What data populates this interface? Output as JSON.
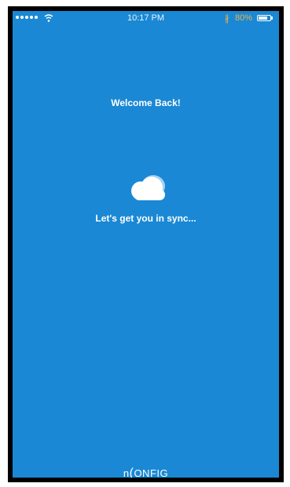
{
  "status_bar": {
    "time": "10:17 PM",
    "battery_percent": "80%",
    "battery_level": 0.8,
    "signal_bars": 5,
    "icons": [
      "signal-dots-icon",
      "wifi-icon",
      "bluetooth-icon",
      "battery-icon"
    ]
  },
  "main": {
    "welcome": "Welcome Back!",
    "sync_message": "Let's get you in sync...",
    "icon": "cloud-icon"
  },
  "footer": {
    "logo_prefix": "n",
    "logo_mark": "(",
    "logo_text": "ONFIG"
  },
  "colors": {
    "background": "#1a88d4",
    "text": "#ffffff",
    "status_accent": "#e9b24a"
  }
}
